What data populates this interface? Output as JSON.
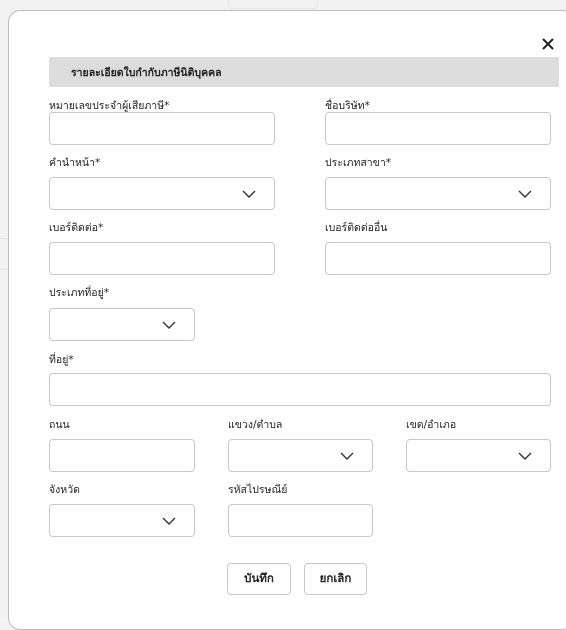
{
  "form": {
    "section_title": "รายละเอียดใบกำกับภาษีนิติบุคคล",
    "labels": {
      "tax_id": "หมายเลขประจำผู้เสียภาษี*",
      "company_name": "ชื่อบริษัท*",
      "prefix": "คำนำหน้า*",
      "branch_type": "ประเภทสาขา*",
      "phone": "เบอร์ติดต่อ*",
      "other_phone": "เบอร์ติดต่ออื่น",
      "address_type": "ประเภทที่อยู่*",
      "address": "ที่อยู่*",
      "road": "ถนน",
      "subdistrict": "แขวง/ตำบล",
      "district": "เขต/อำเภอ",
      "province": "จังหวัด",
      "postal_code": "รหัสไปรษณีย์"
    },
    "values": {
      "tax_id": "",
      "company_name": "",
      "prefix": "",
      "branch_type": "",
      "phone": "",
      "other_phone": "",
      "address_type": "",
      "address": "",
      "road": "",
      "subdistrict": "",
      "district": "",
      "province": "",
      "postal_code": ""
    },
    "buttons": {
      "save": "บันทึก",
      "cancel": "ยกเลิก",
      "close": "×"
    }
  },
  "icons": {
    "close": "close-icon",
    "dropdown": "chevron-down-icon"
  },
  "colors": {
    "header_bg": "#dcdcdc",
    "border": "#c8c8c8",
    "background": "#ffffff"
  }
}
